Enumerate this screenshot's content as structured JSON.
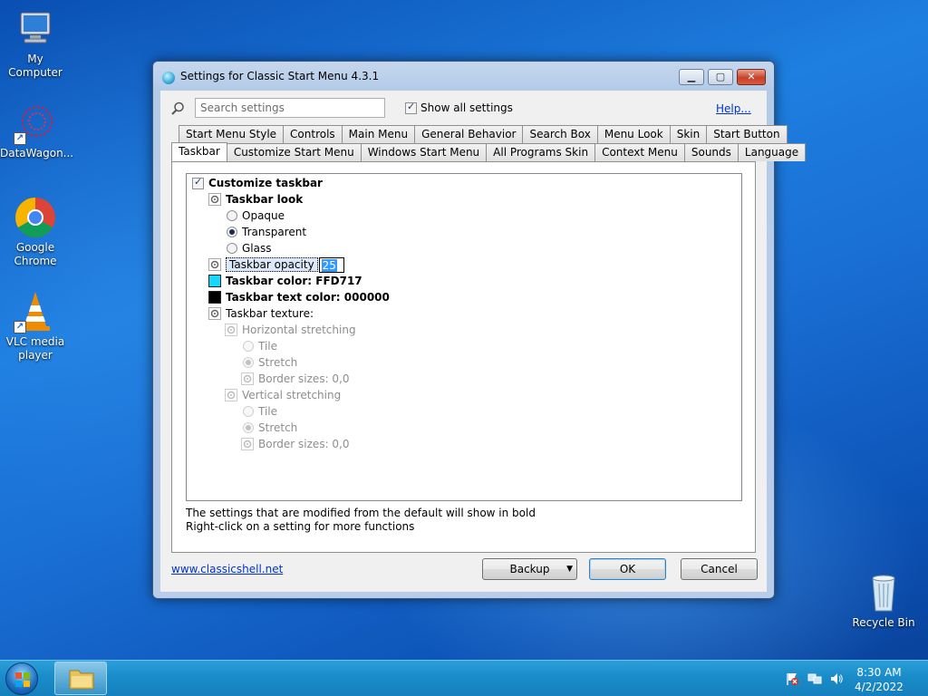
{
  "desktop": {
    "icons": [
      {
        "label": "My Computer"
      },
      {
        "label": "DataWagon..."
      },
      {
        "label": "Google Chrome"
      },
      {
        "label": "VLC media player"
      },
      {
        "label": "Recycle Bin"
      }
    ]
  },
  "window": {
    "title": "Settings for Classic Start Menu 4.3.1",
    "search_placeholder": "Search settings",
    "show_all_label": "Show all settings",
    "help_label": "Help...",
    "tabs_row1": [
      "Start Menu Style",
      "Controls",
      "Main Menu",
      "General Behavior",
      "Search Box",
      "Menu Look",
      "Skin",
      "Start Button"
    ],
    "tabs_row2": [
      "Taskbar",
      "Customize Start Menu",
      "Windows Start Menu",
      "All Programs Skin",
      "Context Menu",
      "Sounds",
      "Language"
    ],
    "active_tab": "Taskbar",
    "tree": {
      "customize_taskbar": "Customize taskbar",
      "taskbar_look": "Taskbar look",
      "opaque": "Opaque",
      "transparent": "Transparent",
      "glass": "Glass",
      "taskbar_opacity": "Taskbar opacity",
      "opacity_value": "25",
      "taskbar_color": "Taskbar color: FFD717",
      "taskbar_text_color": "Taskbar text color: 000000",
      "taskbar_texture": "Taskbar texture:",
      "horizontal_stretching": "Horizontal stretching",
      "h_tile": "Tile",
      "h_stretch": "Stretch",
      "h_border": "Border sizes: 0,0",
      "vertical_stretching": "Vertical stretching",
      "v_tile": "Tile",
      "v_stretch": "Stretch",
      "v_border": "Border sizes: 0,0"
    },
    "note_line1": "The settings that are modified from the default will show in bold",
    "note_line2": "Right-click on a setting for more functions",
    "site_link": "www.classicshell.net",
    "backup_label": "Backup",
    "ok_label": "OK",
    "cancel_label": "Cancel"
  },
  "colors": {
    "taskbar_color_swatch": "#17D7FF",
    "taskbar_text_swatch": "#000000"
  },
  "taskbar": {
    "time": "8:30 AM",
    "date": "4/2/2022"
  }
}
